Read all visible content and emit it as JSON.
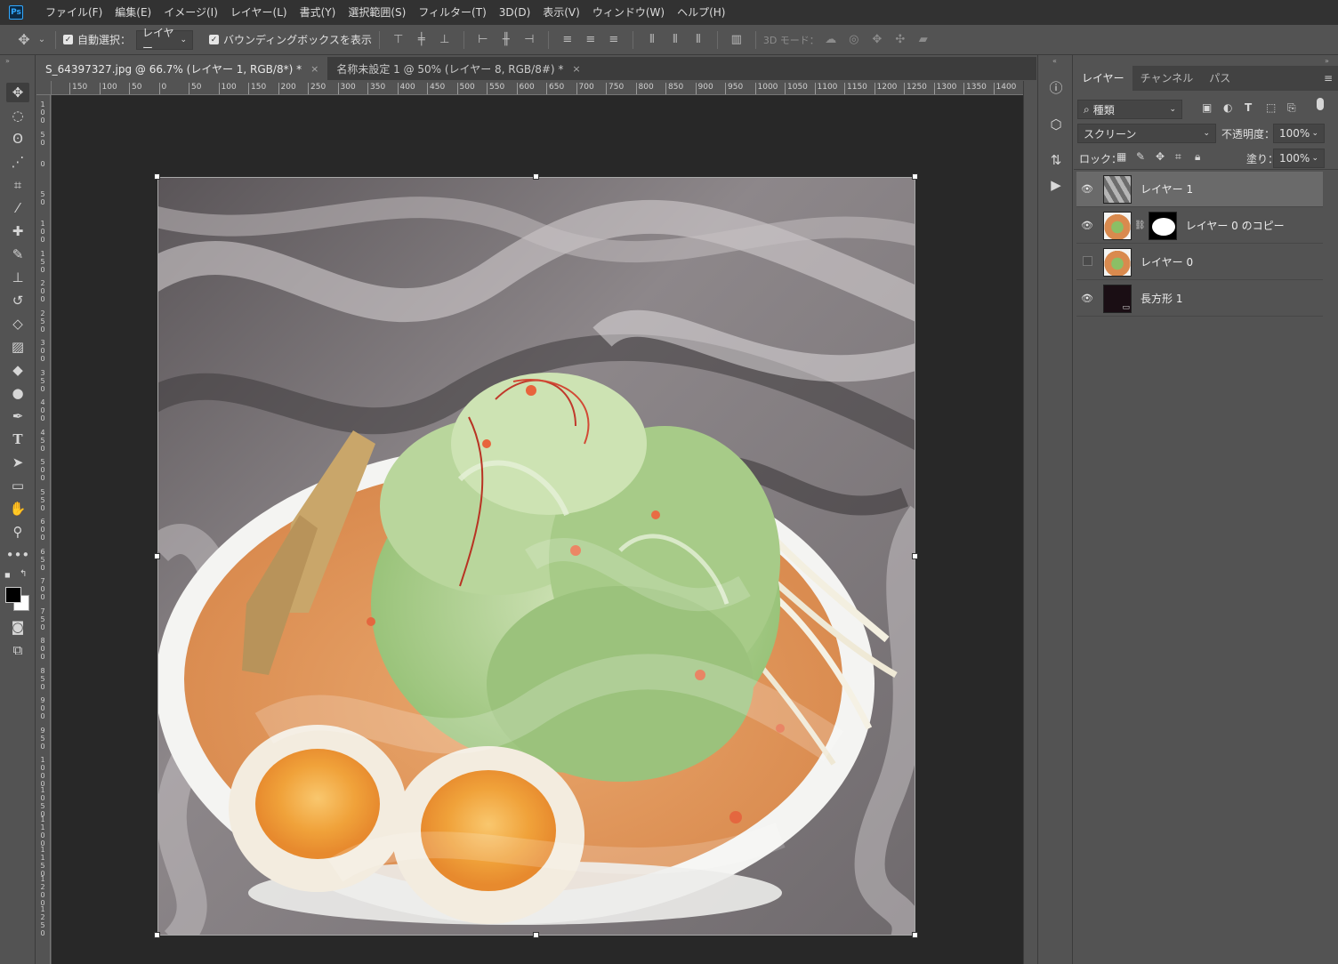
{
  "app": {
    "logo": "Ps",
    "accent": "#31a8ff"
  },
  "menu": [
    "ファイル(F)",
    "編集(E)",
    "イメージ(I)",
    "レイヤー(L)",
    "書式(Y)",
    "選択範囲(S)",
    "フィルター(T)",
    "3D(D)",
    "表示(V)",
    "ウィンドウ(W)",
    "ヘルプ(H)"
  ],
  "options": {
    "auto_select_label": "自動選択：",
    "auto_select_value": "レイヤー",
    "bounding_box_label": "バウンディングボックスを表示",
    "mode_3d_label": "3D モード："
  },
  "tabs": [
    {
      "label": "S_64397327.jpg @ 66.7% (レイヤー 1, RGB/8*) *",
      "close": "×"
    },
    {
      "label": "名称未設定 1 @ 50% (レイヤー 8, RGB/8#) *",
      "close": "×"
    }
  ],
  "ruler": {
    "h_marks": [
      "150",
      "100",
      "50",
      "0",
      "50",
      "100",
      "150",
      "200",
      "250",
      "300",
      "350",
      "400",
      "450",
      "500",
      "550",
      "600",
      "650",
      "700",
      "750",
      "800",
      "850",
      "900",
      "950",
      "1000",
      "1050",
      "1100",
      "1150",
      "1200",
      "1250",
      "1300",
      "1350",
      "1400"
    ],
    "v_marks": [
      "100",
      "50",
      "0",
      "50",
      "100",
      "150",
      "200",
      "250",
      "300",
      "350",
      "400",
      "450",
      "500",
      "550",
      "600",
      "650",
      "700",
      "750",
      "800",
      "850",
      "900",
      "950",
      "1000",
      "1050",
      "1100",
      "1150",
      "1200",
      "1250"
    ]
  },
  "layers_panel": {
    "tabs": [
      "レイヤー",
      "チャンネル",
      "パス"
    ],
    "filter_value": "種類",
    "blend_mode": "スクリーン",
    "opacity_label": "不透明度：",
    "opacity_value": "100%",
    "lock_label": "ロック：",
    "fill_label": "塗り：",
    "fill_value": "100%",
    "layers": [
      {
        "name": "レイヤー 1",
        "visible": true,
        "selected": true
      },
      {
        "name": "レイヤー 0 のコピー",
        "visible": true,
        "selected": false
      },
      {
        "name": "レイヤー 0",
        "visible": false,
        "selected": false
      },
      {
        "name": "長方形 1",
        "visible": true,
        "selected": false
      }
    ]
  }
}
